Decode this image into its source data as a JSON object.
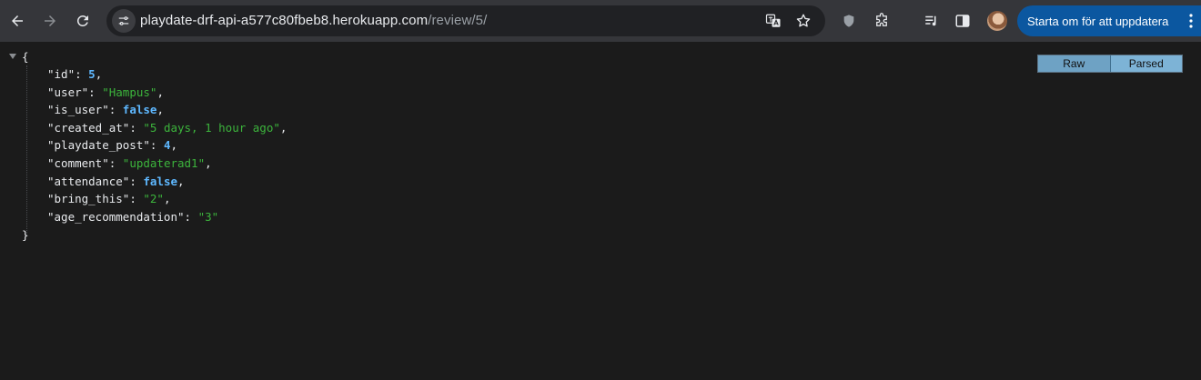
{
  "browser": {
    "url_host": "playdate-drf-api-a577c80fbeb8.herokuapp.com",
    "url_path": "/review/5/",
    "update_button_label": "Starta om för att uppdatera",
    "icons": [
      "back-arrow-icon",
      "forward-arrow-icon",
      "reload-icon",
      "site-info-icon",
      "translate-icon",
      "bookmark-star-icon",
      "shield-extension-icon",
      "extensions-puzzle-icon",
      "media-queue-icon",
      "side-panel-icon",
      "avatar",
      "more-menu-icon"
    ]
  },
  "viewer": {
    "mode_raw": "Raw",
    "mode_parsed": "Parsed",
    "open_brace": "{",
    "close_brace": "}",
    "fields": [
      {
        "key": "\"id\"",
        "value": "5",
        "type": "number",
        "comma": ","
      },
      {
        "key": "\"user\"",
        "value": "\"Hampus\"",
        "type": "string",
        "comma": ","
      },
      {
        "key": "\"is_user\"",
        "value": "false",
        "type": "boolean",
        "comma": ","
      },
      {
        "key": "\"created_at\"",
        "value": "\"5 days, 1 hour ago\"",
        "type": "string",
        "comma": ","
      },
      {
        "key": "\"playdate_post\"",
        "value": "4",
        "type": "number",
        "comma": ","
      },
      {
        "key": "\"comment\"",
        "value": "\"updaterad1\"",
        "type": "string",
        "comma": ","
      },
      {
        "key": "\"attendance\"",
        "value": "false",
        "type": "boolean",
        "comma": ","
      },
      {
        "key": "\"bring_this\"",
        "value": "\"2\"",
        "type": "string",
        "comma": ","
      },
      {
        "key": "\"age_recommendation\"",
        "value": "\"3\"",
        "type": "string",
        "comma": ""
      }
    ],
    "colors": {
      "string": "#3cb43c",
      "number": "#5eb8ff",
      "boolean": "#5eb8ff",
      "accent": "#0b57a0"
    }
  }
}
